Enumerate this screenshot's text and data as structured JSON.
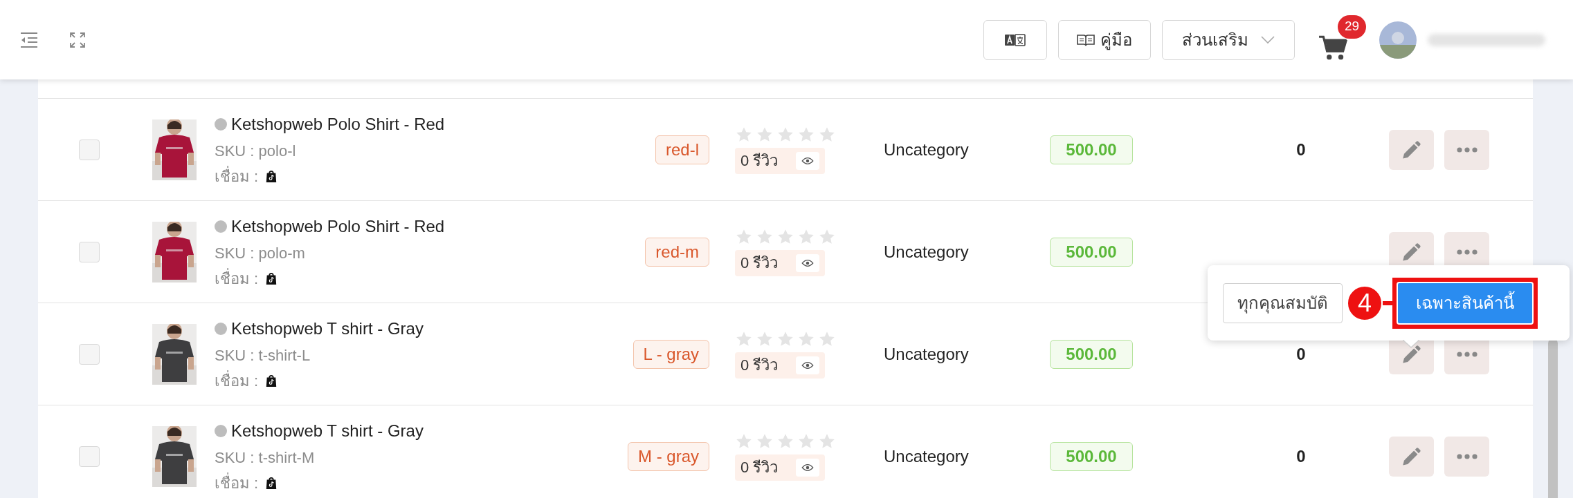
{
  "header": {
    "buttons": [
      {
        "kind": "translate"
      },
      {
        "kind": "manual",
        "label": "คู่มือ"
      },
      {
        "kind": "dropdown",
        "label": "ส่วนเสริม"
      }
    ],
    "cart_count": "29"
  },
  "products": [
    {
      "name": "Ketshopweb Polo Shirt - Red",
      "sku": "SKU : polo-l",
      "link_label": "เชื่อม :",
      "variant": "red-l",
      "stars": 0,
      "reviews": "0 รีวิว",
      "category": "Uncategory",
      "price": "500.00",
      "quantity": "0",
      "checked": false
    },
    {
      "name": "Ketshopweb Polo Shirt - Red",
      "sku": "SKU : polo-m",
      "link_label": "เชื่อม :",
      "variant": "red-m",
      "stars": 0,
      "reviews": "0 รีวิว",
      "category": "Uncategory",
      "price": "500.00",
      "checked": false
    },
    {
      "name": "Ketshopweb T shirt - Gray",
      "sku": "SKU : t-shirt-L",
      "link_label": "เชื่อม :",
      "variant": "L - gray",
      "stars": 0,
      "reviews": "0 รีวิว",
      "category": "Uncategory",
      "price": "500.00",
      "quantity": "0",
      "checked": false
    },
    {
      "name": "Ketshopweb T shirt - Gray",
      "sku": "SKU : t-shirt-M",
      "link_label": "เชื่อม :",
      "variant": "M - gray",
      "stars": 0,
      "reviews": "0 รีวิว",
      "category": "Uncategory",
      "price": "500.00",
      "quantity": "0",
      "checked": false
    }
  ],
  "popover": {
    "buttons": [
      {
        "label": "ทุกคุณสมบัติ",
        "selected": false
      },
      {
        "label": "เฉพาะสินค้านี้",
        "selected": true
      }
    ],
    "step": "4"
  }
}
